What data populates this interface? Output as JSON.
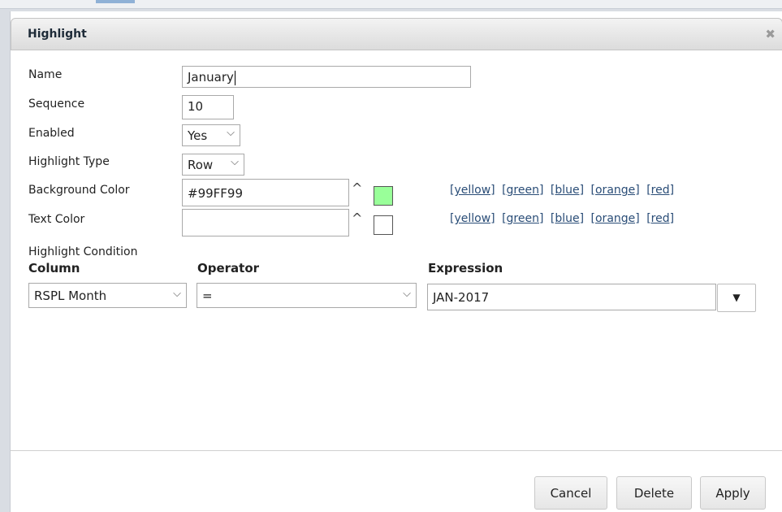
{
  "dialog": {
    "title": "Highlight",
    "close_glyph": "✖"
  },
  "form": {
    "name_label": "Name",
    "name_value": "January",
    "sequence_label": "Sequence",
    "sequence_value": "10",
    "enabled_label": "Enabled",
    "enabled_value": "Yes",
    "type_label": "Highlight Type",
    "type_value": "Row",
    "bg_label": "Background Color",
    "bg_value": "#99FF99",
    "bg_swatch_color": "#99ff99",
    "text_label": "Text Color",
    "text_value": "",
    "text_swatch_color": "#ffffff",
    "picker_glyph": "^",
    "select_arrow_glyph": "⌵",
    "color_links": [
      "[yellow]",
      "[green]",
      "[blue]",
      "[orange]",
      "[red]"
    ]
  },
  "condition": {
    "section_label": "Highlight Condition",
    "column_header": "Column",
    "operator_header": "Operator",
    "expression_header": "Expression",
    "column_value": "RSPL Month",
    "operator_value": "=",
    "expression_value": "JAN-2017",
    "expression_button_glyph": "▼"
  },
  "buttons": {
    "cancel": "Cancel",
    "delete": "Delete",
    "apply": "Apply"
  }
}
